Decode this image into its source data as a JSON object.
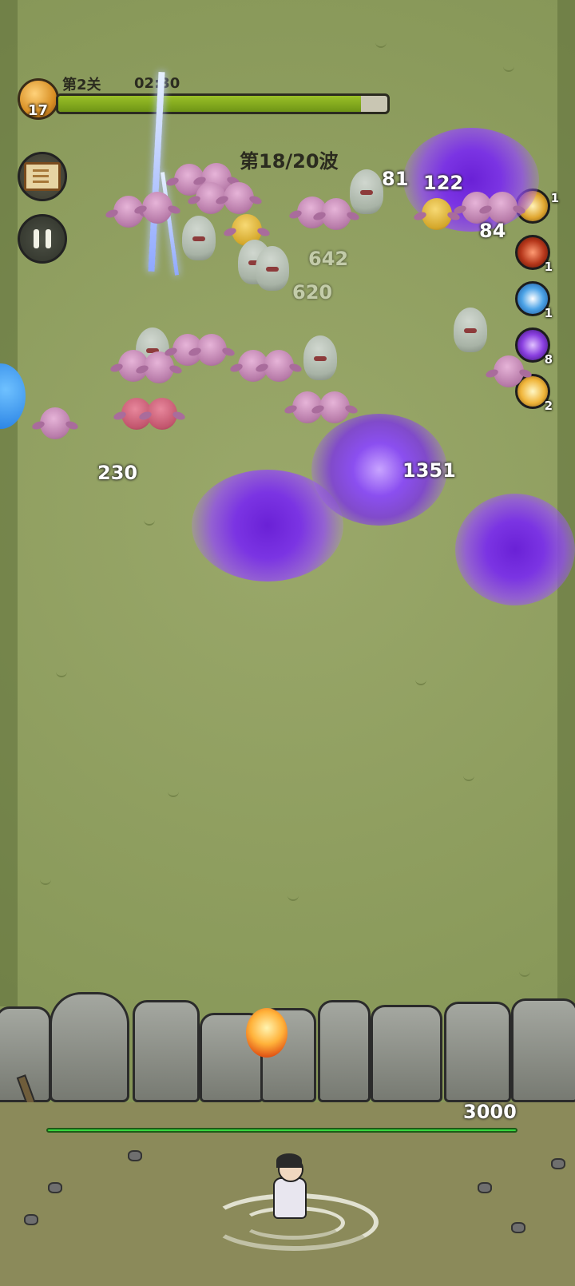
{
  "hud": {
    "player_level": "17",
    "stage_label": "第2关",
    "timer": "02:30",
    "progress_percent": 92,
    "wave_label": "第18/20波"
  },
  "skills": [
    {
      "name": "golden-slash-icon",
      "count": "1"
    },
    {
      "name": "fire-orb-icon",
      "count": "1"
    },
    {
      "name": "frost-orb-icon",
      "count": "1"
    },
    {
      "name": "lightning-orb-icon",
      "count": "8"
    },
    {
      "name": "holy-orb-icon",
      "count": "2"
    }
  ],
  "damage_numbers": {
    "d81": "81",
    "d122": "122",
    "d84": "84",
    "d642": "642",
    "d620": "620",
    "d230": "230",
    "d1351": "1351"
  },
  "wall": {
    "hp": "3000"
  }
}
